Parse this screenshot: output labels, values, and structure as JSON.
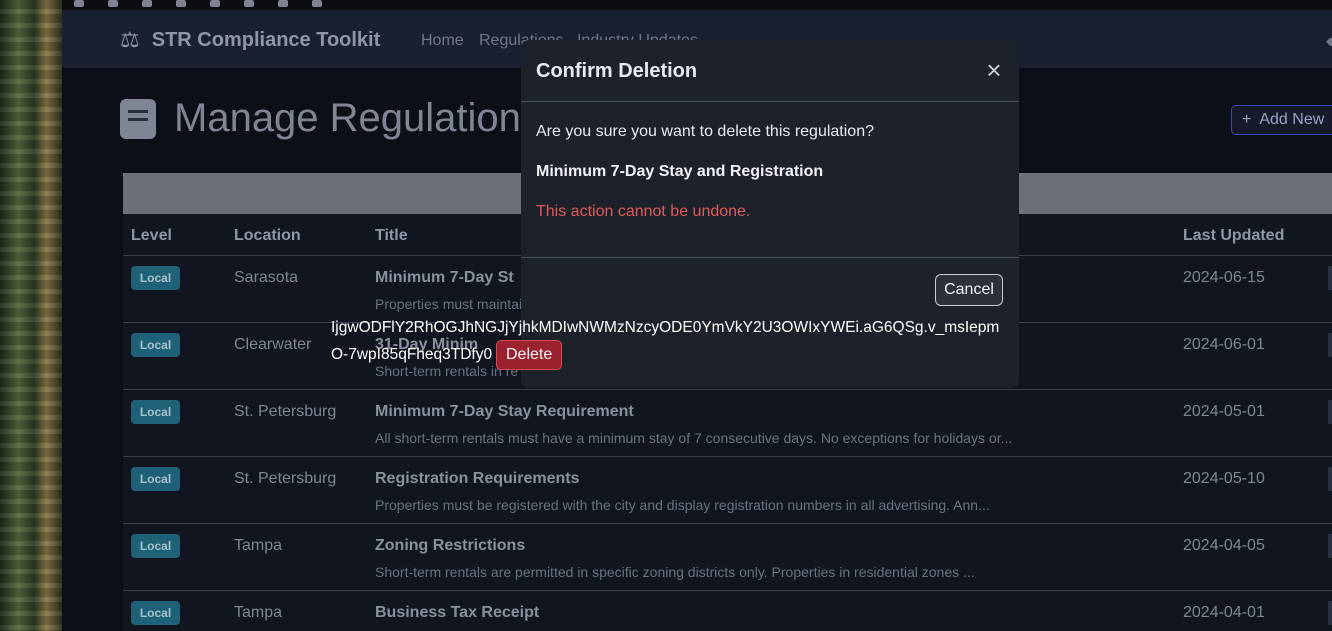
{
  "app": {
    "brand": "STR Compliance Toolkit",
    "nav": [
      "Home",
      "Regulations",
      "Industry Updates"
    ]
  },
  "page": {
    "title": "Manage Regulations",
    "add_new_label": "Add New"
  },
  "table": {
    "headers": {
      "level": "Level",
      "location": "Location",
      "title": "Title",
      "last_updated": "Last Updated"
    },
    "rows": [
      {
        "level": "Local",
        "location": "Sarasota",
        "title": "Minimum 7-Day St",
        "desc": "Properties must maintai",
        "date": "2024-06-15"
      },
      {
        "level": "Local",
        "location": "Clearwater",
        "title": "31-Day Minim",
        "desc": "Short-term rentals in re",
        "date": "2024-06-01"
      },
      {
        "level": "Local",
        "location": "St. Petersburg",
        "title": "Minimum 7-Day Stay Requirement",
        "desc": "All short-term rentals must have a minimum stay of 7 consecutive days. No exceptions for holidays or...",
        "date": "2024-05-01"
      },
      {
        "level": "Local",
        "location": "St. Petersburg",
        "title": "Registration Requirements",
        "desc": "Properties must be registered with the city and display registration numbers in all advertising. Ann...",
        "date": "2024-05-10"
      },
      {
        "level": "Local",
        "location": "Tampa",
        "title": "Zoning Restrictions",
        "desc": "Short-term rentals are permitted in specific zoning districts only. Properties in residential zones ...",
        "date": "2024-04-05"
      },
      {
        "level": "Local",
        "location": "Tampa",
        "title": "Business Tax Receipt",
        "desc": "",
        "date": "2024-04-01"
      }
    ]
  },
  "modal": {
    "title": "Confirm Deletion",
    "question": "Are you sure you want to delete this regulation?",
    "item_name": "Minimum 7-Day Stay and Registration",
    "warning": "This action cannot be undone.",
    "cancel_label": "Cancel",
    "token": "IjgwODFlY2RhOGJhNGJjYjhkMDIwNWMzNzcyODE0YmVkY2U3OWIxYWEi.aG6QSg.v_msIepmO-7wpI85qFheq3TDfy0",
    "delete_label": "Delete"
  },
  "colors": {
    "badge": "#1f6277",
    "warning": "#e05a5a",
    "delete": "#9b2330"
  }
}
